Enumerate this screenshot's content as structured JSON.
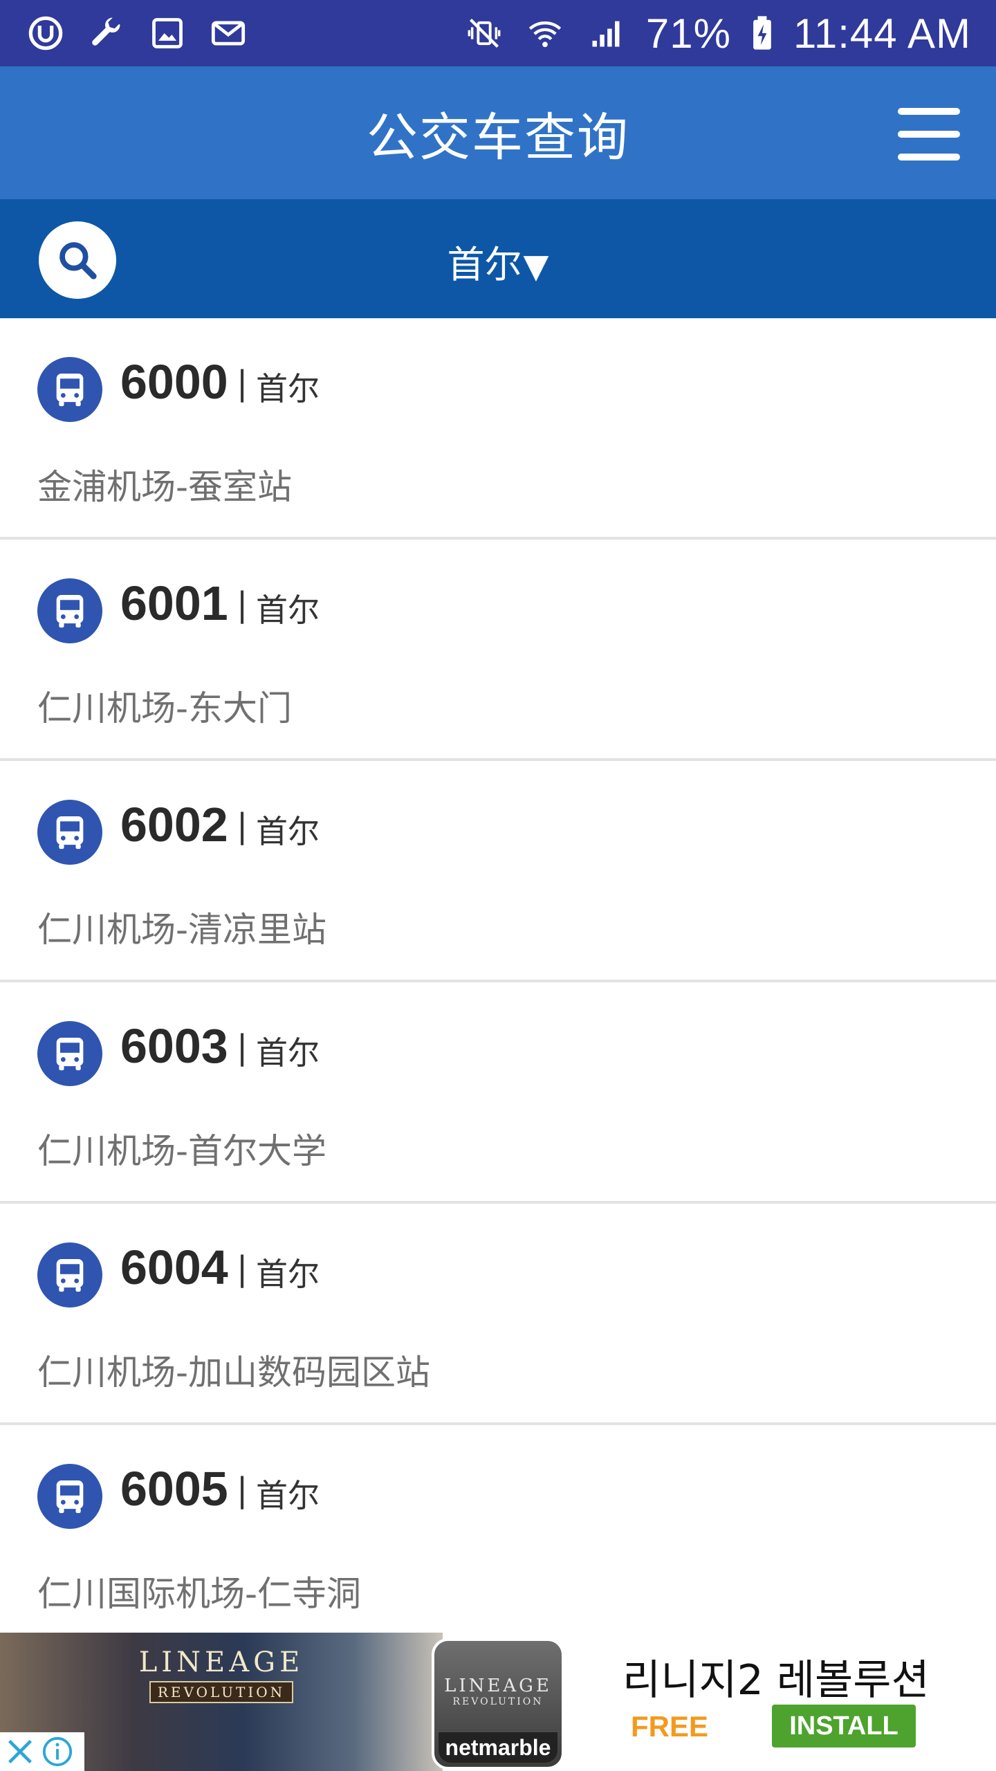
{
  "status_bar": {
    "left_icons": [
      "uc-browser-icon",
      "wrench-icon",
      "image-icon",
      "gmail-icon"
    ],
    "right_icons": [
      "vibrate-mute-icon",
      "wifi-icon",
      "cell-signal-icon",
      "battery-charging-icon"
    ],
    "battery": "71%",
    "time": "11:44 AM"
  },
  "app_bar": {
    "title": "公交车查询",
    "menu_icon": "hamburger-menu-icon"
  },
  "filter_bar": {
    "search_icon": "search-icon",
    "city": "首尔",
    "caret": "▼"
  },
  "routes": [
    {
      "number": "6000",
      "city": "首尔",
      "desc": "金浦机场-蚕室站"
    },
    {
      "number": "6001",
      "city": "首尔",
      "desc": "仁川机场-东大门"
    },
    {
      "number": "6002",
      "city": "首尔",
      "desc": "仁川机场-清凉里站"
    },
    {
      "number": "6003",
      "city": "首尔",
      "desc": "仁川机场-首尔大学"
    },
    {
      "number": "6004",
      "city": "首尔",
      "desc": "仁川机场-加山数码园区站"
    },
    {
      "number": "6005",
      "city": "首尔",
      "desc": "仁川国际机场-仁寺洞"
    }
  ],
  "route_separator": "|",
  "ad": {
    "art_logo_line1": "LINEAGE",
    "art_logo_line2": "REVOLUTION",
    "icon_logo_line1": "LINEAGE",
    "icon_logo_line2": "REVOLUTION",
    "icon_brand": "netmarble",
    "title": "리니지2 레볼루션",
    "price": "FREE",
    "install_label": "INSTALL",
    "colors": {
      "price": "#f39a1e",
      "install_bg": "#4da32d"
    }
  },
  "colors": {
    "status_bar": "#2f3a9a",
    "app_bar": "#3073c6",
    "filter_bar": "#0d57a6",
    "bus_icon_bg": "#2f55b0"
  }
}
